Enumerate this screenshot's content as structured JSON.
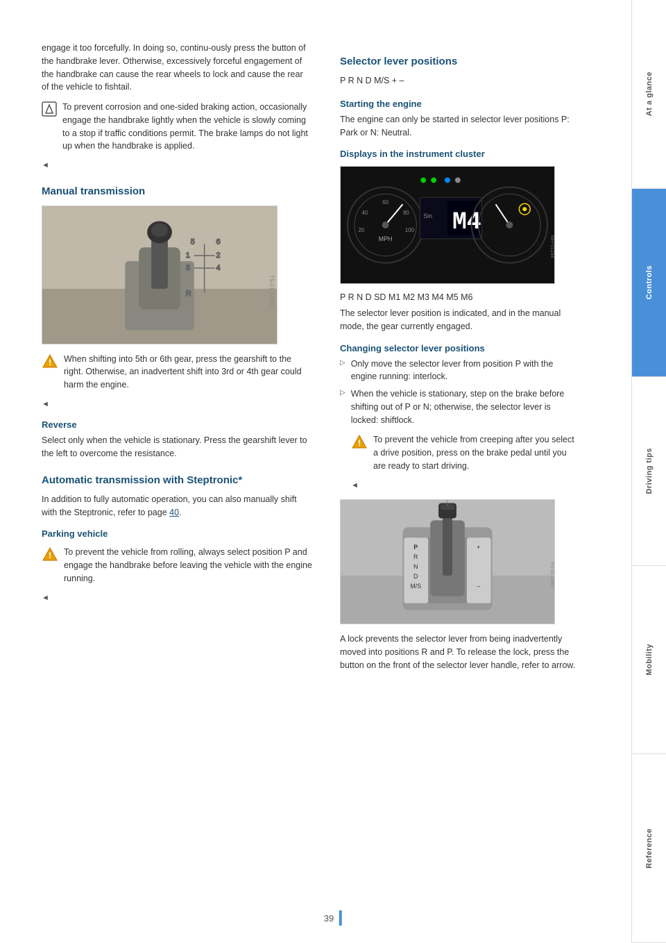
{
  "page": {
    "number": "39"
  },
  "sidebar": {
    "sections": [
      {
        "label": "At a glance",
        "active": false
      },
      {
        "label": "Controls",
        "active": true
      },
      {
        "label": "Driving tips",
        "active": false
      },
      {
        "label": "Mobility",
        "active": false
      },
      {
        "label": "Reference",
        "active": false
      }
    ]
  },
  "left_column": {
    "intro_text": "engage it too forcefully. In doing so, continu-ously press the button of the handbrake lever. Otherwise, excessively forceful engagement of the handbrake can cause the rear wheels to lock and cause the rear of the vehicle to fishtail.",
    "note_text": "To prevent corrosion and one-sided braking action, occasionally engage the handbrake lightly when the vehicle is slowly coming to a stop if traffic conditions permit. The brake lamps do not light up when the handbrake is applied.",
    "back_arrow": "◄",
    "manual_transmission": {
      "heading": "Manual transmission",
      "warning_text": "When shifting into 5th or 6th gear, press the gearshift to the right. Otherwise, an inadvertent shift into 3rd or 4th gear could harm the engine.",
      "back_arrow": "◄",
      "reverse": {
        "subheading": "Reverse",
        "text": "Select only when the vehicle is stationary. Press the gearshift lever to the left to overcome the resistance."
      }
    },
    "automatic_transmission": {
      "heading": "Automatic transmission with Steptronic*",
      "intro_text": "In addition to fully automatic operation, you can also manually shift with the Steptronic, refer to page",
      "page_link": "40",
      "period": ".",
      "parking_vehicle": {
        "subheading": "Parking vehicle",
        "warning_text": "To prevent the vehicle from rolling, always select position P and engage the handbrake before leaving the vehicle with the engine running.",
        "back_arrow": "◄"
      }
    }
  },
  "right_column": {
    "selector_lever": {
      "heading": "Selector lever positions",
      "positions": "P R N D M/S + –"
    },
    "starting_engine": {
      "heading": "Starting the engine",
      "text": "The engine can only be started in selector lever positions P: Park or N: Neutral."
    },
    "instrument_cluster": {
      "heading": "Displays in the instrument cluster",
      "positions_text": "P R N D SD M1 M2 M3 M4 M5 M6",
      "description": "The selector lever position is indicated, and in the manual mode, the gear currently engaged."
    },
    "changing_positions": {
      "heading": "Changing selector lever positions",
      "bullet1": "Only move the selector lever from position P with the engine running: interlock.",
      "bullet2": "When the vehicle is stationary, step on the brake before shifting out of P or N; otherwise, the selector lever is locked: shiftlock.",
      "warning_text": "To prevent the vehicle from creeping after you select a drive position, press on the brake pedal until you are ready to start driving.",
      "back_arrow": "◄",
      "final_text": "A lock prevents the selector lever from being inadvertently moved into positions R and P. To release the lock, press the button on the front of the selector lever handle, refer to arrow."
    }
  }
}
